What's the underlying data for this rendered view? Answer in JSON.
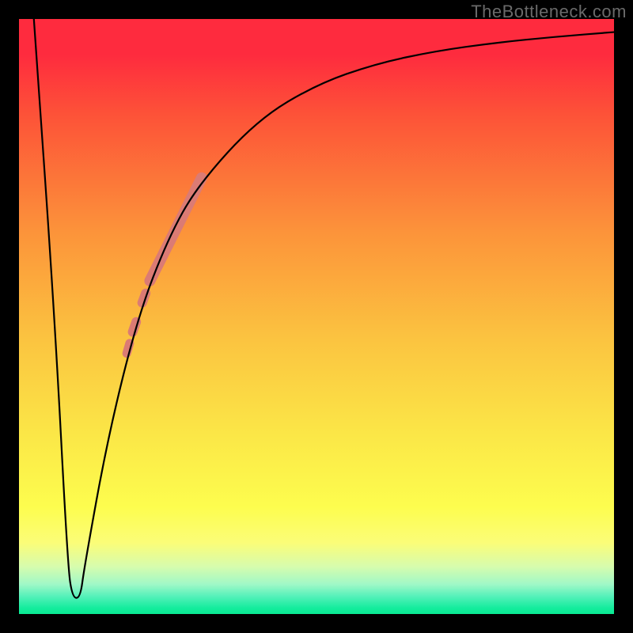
{
  "watermark": "TheBottleneck.com",
  "chart_data": {
    "type": "line",
    "title": "",
    "xlabel": "",
    "ylabel": "",
    "xlim": [
      0,
      100
    ],
    "ylim": [
      0,
      100
    ],
    "grid": false,
    "curve_points": [
      {
        "x": 2.5,
        "y": 100
      },
      {
        "x": 6.0,
        "y": 50
      },
      {
        "x": 8.2,
        "y": 8
      },
      {
        "x": 9.0,
        "y": 2.7
      },
      {
        "x": 10.3,
        "y": 2.7
      },
      {
        "x": 11.0,
        "y": 8
      },
      {
        "x": 15.0,
        "y": 30
      },
      {
        "x": 20.0,
        "y": 50
      },
      {
        "x": 25.0,
        "y": 63
      },
      {
        "x": 30.0,
        "y": 72
      },
      {
        "x": 40.0,
        "y": 83
      },
      {
        "x": 50.0,
        "y": 89
      },
      {
        "x": 60.0,
        "y": 92.5
      },
      {
        "x": 70.0,
        "y": 94.6
      },
      {
        "x": 80.0,
        "y": 96
      },
      {
        "x": 90.0,
        "y": 97
      },
      {
        "x": 100.0,
        "y": 97.8
      }
    ],
    "highlight_segments": [
      {
        "x1": 22.0,
        "y1": 56.0,
        "x2": 30.7,
        "y2": 73.3,
        "width": 14
      },
      {
        "x1": 20.7,
        "y1": 52.3,
        "x2": 21.3,
        "y2": 53.9,
        "width": 12
      },
      {
        "x1": 19.1,
        "y1": 47.4,
        "x2": 19.7,
        "y2": 49.1,
        "width": 12
      },
      {
        "x1": 18.1,
        "y1": 43.8,
        "x2": 18.6,
        "y2": 45.5,
        "width": 11
      }
    ],
    "highlight_color": "#db7b74",
    "curve_color": "#000000"
  }
}
